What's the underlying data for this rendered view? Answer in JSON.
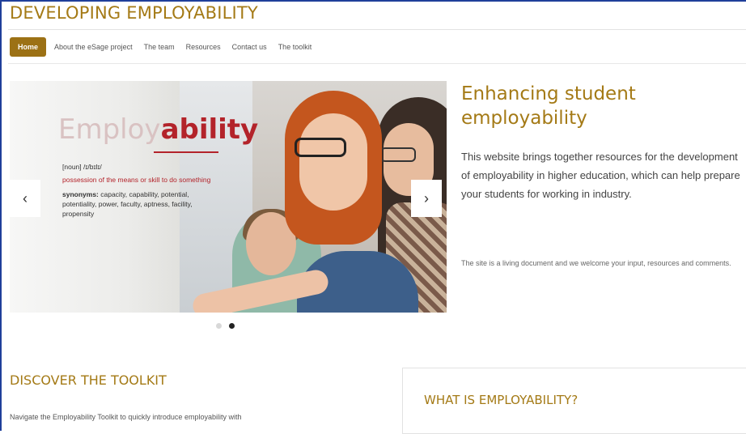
{
  "site": {
    "title": "DEVELOPING EMPLOYABILITY"
  },
  "nav": {
    "items": [
      {
        "label": "Home",
        "active": true
      },
      {
        "label": "About the eSage project",
        "active": false
      },
      {
        "label": "The team",
        "active": false
      },
      {
        "label": "Resources",
        "active": false
      },
      {
        "label": "Contact us",
        "active": false
      },
      {
        "label": "The toolkit",
        "active": false
      }
    ],
    "active_color": "#9c7115"
  },
  "carousel": {
    "slide": {
      "word_light": "Employ",
      "word_bold": "ability",
      "noun": "[noun] /ɪ/bɪlɪ/",
      "meaning": "possession of the means or skill to do something",
      "synonyms_label": "synonyms:",
      "synonyms": "capacity, capability, potential, potentiality, power, faculty, aptness, facility, propensity"
    },
    "prev_icon": "chevron-left-icon",
    "next_icon": "chevron-right-icon",
    "prev_glyph": "‹",
    "next_glyph": "›",
    "slides_total": 2,
    "active_slide": 2
  },
  "hero": {
    "title": "Enhancing student employability",
    "text": "This website brings together resources for the development of employability in higher education, which can help prepare your students for working in industry.",
    "small": "The site is a living document and we welcome your input, resources and comments."
  },
  "discover": {
    "title": "DISCOVER THE TOOLKIT",
    "text": "Navigate the Employability Toolkit to quickly introduce employability with"
  },
  "what_is": {
    "title": "WHAT IS EMPLOYABILITY?"
  },
  "colors": {
    "accent": "#a47a16",
    "border": "#1f3f9a",
    "definition_red": "#b3232a"
  }
}
